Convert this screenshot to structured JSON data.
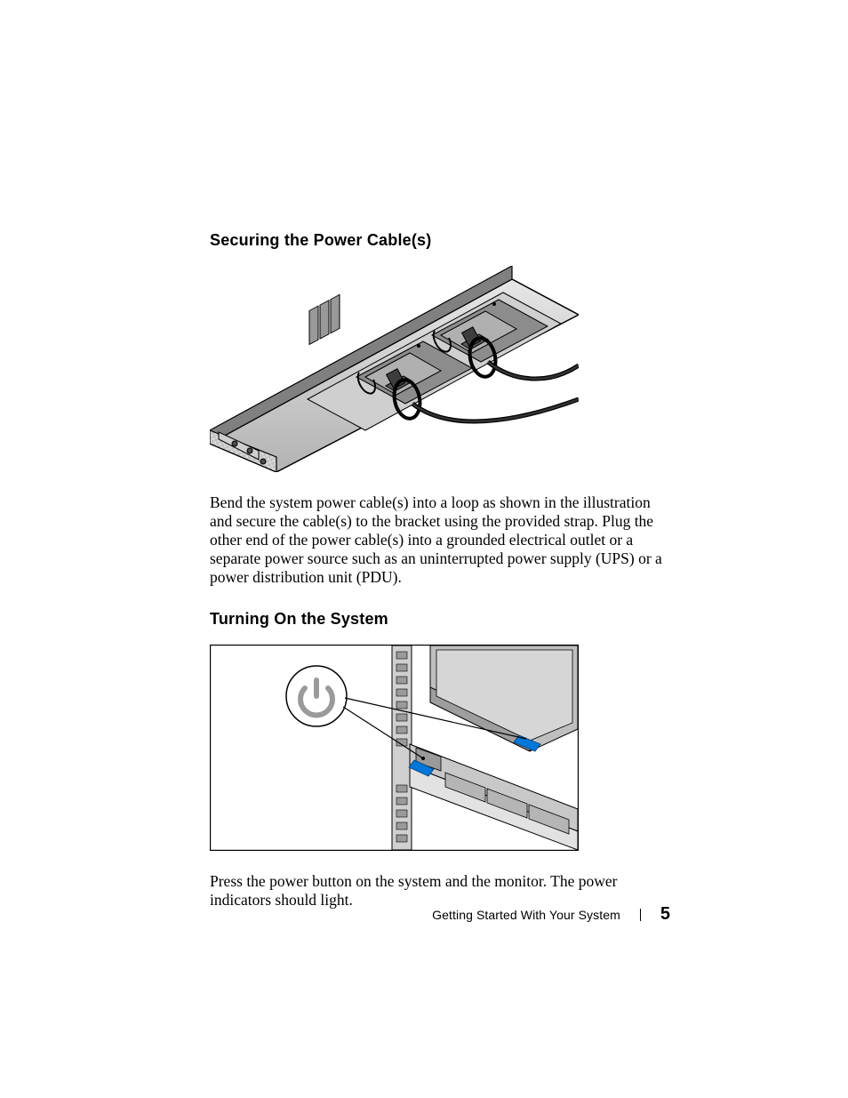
{
  "sections": {
    "securing": {
      "heading": "Securing the Power Cable(s)",
      "body": "Bend the system power cable(s) into a loop as shown in the illustration and secure the cable(s) to the bracket using the provided strap. Plug the other end of the power cable(s) into a grounded electrical outlet or a separate power source such as an uninterrupted power supply (UPS) or a power distribution unit (PDU)."
    },
    "turning_on": {
      "heading": "Turning On the System",
      "body": "Press the power button on the system and the monitor. The power indicators should light."
    }
  },
  "footer": {
    "title": "Getting Started With Your System",
    "page": "5"
  }
}
